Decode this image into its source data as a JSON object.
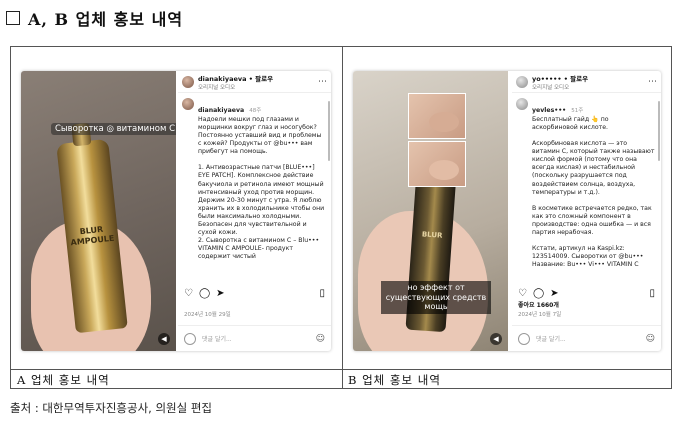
{
  "heading": {
    "title": "A, B 업체 홍보 내역"
  },
  "captions": {
    "a": "A 업체 홍보 내역",
    "b": "B 업체 홍보 내역"
  },
  "source": "출처 : 대한무역투자진흥공사, 의원실 편집",
  "post_a": {
    "overlay_tag": "Сыворотка ◎ витамином C",
    "bottle_brand": "BLUR AMPOULE",
    "account": "dianakiyaeva • 팔로우",
    "account_sub": "오리지널 오디오",
    "poster": "dianakiyaeva",
    "time": "48주",
    "caption": "Надоели мешки под глазами и морщинки вокруг глаз и носогубок? Постоянно уставший вид и проблемы с кожей? Продукты от @bu••• вам прибегут на помощь.\n\n1. Антивозрастные патчи [BLUE•••] EYE PATCH]. Комплексное действие бакучиола и ретинола имеют мощный интенсивный уход против морщин. Держим 20-30 минут с утра. Я люблю хранить их в холодильнике чтобы они были максимально холодными. Безопасен для чувствительной и сухой кожи.\n2. Сыворотка с витамином C – Blu••• VITAMIN C AMPOULE- продукт содержит чистый",
    "likes": "",
    "date": "2024년 10월 29일",
    "comment_placeholder": "댓글 달기..."
  },
  "post_b": {
    "overlay_sub": "но эффект от существующих средств мощь",
    "bottle_brand": "BLUR",
    "account": "yo••••• • 팔로우",
    "account_sub": "오리지널 오디오",
    "poster": "yevles•••",
    "time": "51주",
    "caption": "Бесплатный гайд 👆 по аскорбиновой кислоте.\n\nАскорбиновая кислота — это витамин C, который также называют кислой формой (потому что она всегда кислая) и нестабильной (поскольку разрушается под воздействием солнца, воздуха, температуры и т.д.).\n\nВ косметике встречается редко, так как это сложный компонент в производстве: одна ошибка — и вся партия нерабочая.\n\nКстати, артикул на Kaspi.kz: 123514009. Сыворотки от @bu••• Название: Bu••• Vi••• VITAMIN C",
    "likes": "좋아요 1660개",
    "date": "2024년 10월 7일",
    "comment_placeholder": "댓글 달기..."
  }
}
